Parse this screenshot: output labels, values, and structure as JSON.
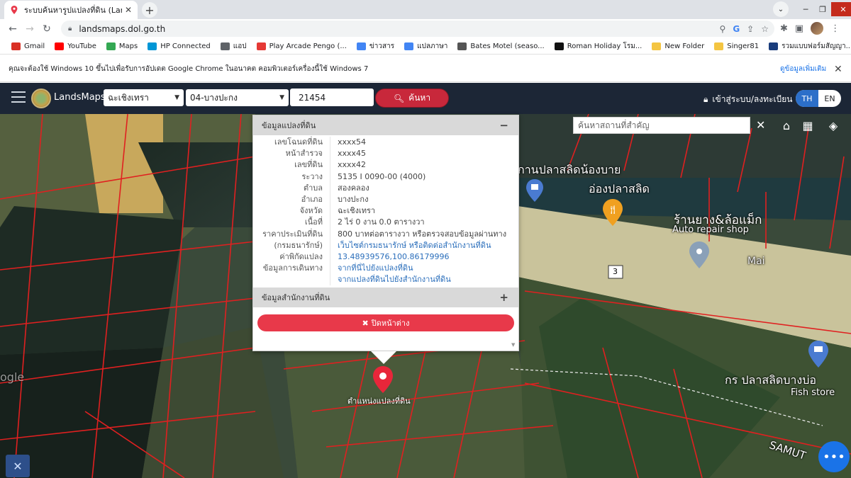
{
  "browser": {
    "tab_title": "ระบบค้นหารูปแปลงที่ดิน (LandsMa",
    "url": "landsmaps.dol.go.th",
    "bookmarks": [
      {
        "label": "Gmail",
        "color": "#d93025"
      },
      {
        "label": "YouTube",
        "color": "#ff0000"
      },
      {
        "label": "Maps",
        "color": "#34a853"
      },
      {
        "label": "HP Connected",
        "color": "#0096d6"
      },
      {
        "label": "แอป",
        "color": "#5f6368"
      },
      {
        "label": "Play Arcade Pengo (...",
        "color": "#e53935"
      },
      {
        "label": "ข่าวสาร",
        "color": "#4285f4"
      },
      {
        "label": "แปลภาษา",
        "color": "#4285f4"
      },
      {
        "label": "Bates Motel (seaso...",
        "color": "#555555"
      },
      {
        "label": "Roman Holiday โรม...",
        "color": "#111111"
      },
      {
        "label": "New Folder",
        "color": "#f4c542"
      },
      {
        "label": "Singer81",
        "color": "#f4c542"
      },
      {
        "label": "รวมแบบฟอร์มสัญญา...",
        "color": "#1a3d7c"
      }
    ],
    "infobar_text": "คุณจะต้องใช้ Windows 10 ขึ้นไปเพื่อรับการอัปเดต Google Chrome ในอนาคต คอมพิวเตอร์เครื่องนี้ใช้ Windows 7",
    "infobar_link": "ดูข้อมูลเพิ่มเติม"
  },
  "app": {
    "brand": "LandsMaps",
    "province": "ฉะเชิงเทรา",
    "district": "04-บางปะกง",
    "parcel_input": "21454",
    "search_label": "ค้นหา",
    "login_label": "เข้าสู่ระบบ/ลงทะเบียน",
    "lang_th": "TH",
    "lang_en": "EN"
  },
  "map": {
    "place_search_placeholder": "ค้นหาสถานที่สำคัญ",
    "pin_label": "ตำแหน่งแปลงที่ดิน",
    "labels": {
      "l1": "กานปลาสลิดน้องบาย",
      "l2": "อ่องปลาสลิด",
      "l3": "ร้านยาง&ล้อแม็ก",
      "l4": "Auto repair shop",
      "l5": "Mai",
      "l6": "กร ปลาสลิดบางบ่อ",
      "l7": "Fish store",
      "l8": "SAMUT",
      "l9": "3",
      "l10": "ogle"
    }
  },
  "popup": {
    "section1_title": "ข้อมูลแปลงที่ดิน",
    "rows": [
      {
        "k": "เลขโฉนดที่ดิน",
        "v": "xxxx54",
        "link": false
      },
      {
        "k": "หน้าสำรวจ",
        "v": "xxxx45",
        "link": false
      },
      {
        "k": "เลขที่ดิน",
        "v": "xxxx42",
        "link": false
      },
      {
        "k": "ระวาง",
        "v": "5135 I 0090-00 (4000)",
        "link": false
      },
      {
        "k": "ตำบล",
        "v": "สองคลอง",
        "link": false
      },
      {
        "k": "อำเภอ",
        "v": "บางปะกง",
        "link": false
      },
      {
        "k": "จังหวัด",
        "v": "ฉะเชิงเทรา",
        "link": false
      },
      {
        "k": "เนื้อที่",
        "v": "2 ไร่ 0 งาน 0.0 ตารางวา",
        "link": false
      },
      {
        "k": "ราคาประเมินที่ดิน",
        "v": "800 บาทต่อตารางวา หรือตรวจสอบข้อมูลผ่านทาง",
        "link": false
      },
      {
        "k": "(กรมธนารักษ์)",
        "v": "เว็บไซต์กรมธนารักษ์ หรือติดต่อสำนักงานที่ดิน",
        "link": true
      },
      {
        "k": "ค่าพิกัดแปลง",
        "v": "13.48939576,100.86179996",
        "link": true
      },
      {
        "k": "ข้อมูลการเดินทาง",
        "v": "จากที่นี่ไปยังแปลงที่ดิน",
        "link": true
      },
      {
        "k": "",
        "v": "จากแปลงที่ดินไปยังสำนักงานที่ดิน",
        "link": true
      }
    ],
    "section2_title": "ข้อมูลสำนักงานที่ดิน",
    "close_label": "ปิดหน้าต่าง"
  }
}
